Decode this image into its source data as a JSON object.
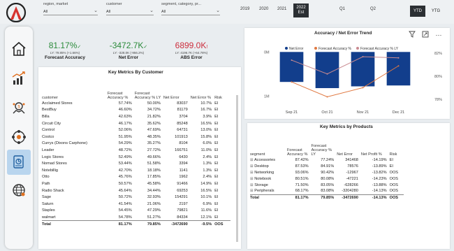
{
  "filters": [
    {
      "label": "region, market",
      "value": "All"
    },
    {
      "label": "customer",
      "value": "All"
    },
    {
      "label": "segment, category, pr...",
      "value": "All"
    }
  ],
  "years": [
    "2019",
    "2020",
    "2021",
    "2022",
    "Q1",
    "Q2"
  ],
  "year_selected_sub": "Est",
  "period_toggle": {
    "ytd": "YTD",
    "ytg": "YTG"
  },
  "sidebar": [
    "home-icon",
    "growth-chart-icon",
    "finance-icon",
    "supply-chain-icon",
    "forecast-doc-icon",
    "global-icon"
  ],
  "kpis": {
    "forecast_accuracy": {
      "value": "81.17%",
      "mark": "✓",
      "sub": "LY: 79.85% (+1.66%)",
      "label": "Forecast Accuracy",
      "color": "#2a8a3a"
    },
    "net_error": {
      "value": "-3472.7K",
      "mark": "✓",
      "sub": "LY: -328.0K (-956.2%)",
      "label": "Net Error",
      "color": "#2a8a3a"
    },
    "abs_error": {
      "value": "6899.0K",
      "mark": "!",
      "sub": "LY: 4196.7K (+64.78%)",
      "label": "ABS Error",
      "color": "#cc2d3c"
    }
  },
  "customer_table": {
    "title": "Key Metrics By Customer",
    "headers": [
      "customer",
      "Forecast Accuracy %",
      "Forecast Accuracy % LY",
      "Net Error",
      "Net Error %",
      "Risk"
    ],
    "rows": [
      [
        "Acclaimed Stores",
        "57.74%",
        "50.00%",
        "83037",
        "10.7%",
        "EI"
      ],
      [
        "BestBuy",
        "46.60%",
        "34.72%",
        "81179",
        "16.7%",
        "EI"
      ],
      [
        "Billa",
        "42.63%",
        "21.82%",
        "3704",
        "3.9%",
        "EI"
      ],
      [
        "Circuit City",
        "46.17%",
        "35.62%",
        "85248",
        "16.5%",
        "EI"
      ],
      [
        "Control",
        "52.06%",
        "47.69%",
        "64731",
        "13.0%",
        "EI"
      ],
      [
        "Costco",
        "51.95%",
        "48.35%",
        "101913",
        "15.8%",
        "EI"
      ],
      [
        "Currys (Dixons Carphone)",
        "54.29%",
        "35.27%",
        "8104",
        "6.0%",
        "EI"
      ],
      [
        "Leader",
        "48.72%",
        "27.72%",
        "166751",
        "11.0%",
        "EI"
      ],
      [
        "Logic Stores",
        "52.49%",
        "49.66%",
        "6430",
        "2.4%",
        "EI"
      ],
      [
        "Nomad Stores",
        "53.44%",
        "51.58%",
        "3394",
        "1.3%",
        "EI"
      ],
      [
        "Notebillig",
        "42.70%",
        "18.18%",
        "1141",
        "1.3%",
        "EI"
      ],
      [
        "Otto",
        "45.76%",
        "17.85%",
        "1962",
        "2.4%",
        "EI"
      ],
      [
        "Path",
        "50.57%",
        "45.58%",
        "91466",
        "14.9%",
        "EI"
      ],
      [
        "Radio Shack",
        "45.64%",
        "34.44%",
        "69253",
        "16.5%",
        "EI"
      ],
      [
        "Sage",
        "50.72%",
        "32.93%",
        "154291",
        "10.1%",
        "EI"
      ],
      [
        "Saturn",
        "41.54%",
        "21.06%",
        "2197",
        "6.9%",
        "EI"
      ],
      [
        "Staples",
        "54.45%",
        "47.29%",
        "79821",
        "11.6%",
        "EI"
      ],
      [
        "walmart",
        "54.78%",
        "51.27%",
        "84334",
        "12.1%",
        "EI"
      ]
    ],
    "total": [
      "Total",
      "81.17%",
      "79.85%",
      "-3472690",
      "-9.5%",
      "OOS"
    ]
  },
  "trend_chart": {
    "title": "Accuracy / Net Error Trend",
    "legend": [
      "Net Error",
      "Forecast Accuracy %",
      "Forecast Accuracy % LY"
    ]
  },
  "chart_data": {
    "type": "bar",
    "title": "Accuracy / Net Error Trend",
    "categories": [
      "Sep 21",
      "Oct 21",
      "Nov 21",
      "Dec 21"
    ],
    "y_left_ticks": [
      "0M",
      "1M"
    ],
    "y_right_ticks": [
      "82%",
      "80%",
      "78%"
    ],
    "series": [
      {
        "name": "Net Error",
        "type": "bar",
        "values": [
          -0.68,
          -0.82,
          -0.78,
          -0.76
        ],
        "color": "#123e8c"
      },
      {
        "name": "Forecast Accuracy %",
        "type": "line",
        "values": [
          79.5,
          78.2,
          79.0,
          80.9
        ],
        "color": "#e07840"
      },
      {
        "name": "Forecast Accuracy % LY",
        "type": "line",
        "values": [
          81.4,
          80.2,
          81.7,
          81.6
        ],
        "color": "#c98a90"
      }
    ],
    "y_left_range": [
      -1.2,
      0.1
    ],
    "y_right_range": [
      77.5,
      82.5
    ],
    "legend_position": "top"
  },
  "product_table": {
    "title": "Key Metrics by Products",
    "headers": [
      "segment",
      "Forecast Accuracy %",
      "Forecast Accuracy % LY",
      "Net Error",
      "Net Profit %",
      "Risk"
    ],
    "rows": [
      [
        "Accessories",
        "87.42%",
        "77.24%",
        "341468",
        "-14.19%",
        "EI"
      ],
      [
        "Desktop",
        "87.53%",
        "84.91%",
        "78576",
        "-13.89%",
        "EI"
      ],
      [
        "Networking",
        "93.06%",
        "90.42%",
        "-12967",
        "-13.82%",
        "OOS"
      ],
      [
        "Notebook",
        "80.51%",
        "80.08%",
        "-47221",
        "-14.23%",
        "OOS"
      ],
      [
        "Storage",
        "71.50%",
        "83.05%",
        "-628266",
        "-13.88%",
        "OOS"
      ],
      [
        "Peripherals",
        "68.17%",
        "83.08%",
        "-3204280",
        "-14.13%",
        "OOS"
      ]
    ],
    "total": [
      "Total",
      "81.17%",
      "79.85%",
      "-3472690",
      "-14.13%",
      "OOS"
    ]
  }
}
